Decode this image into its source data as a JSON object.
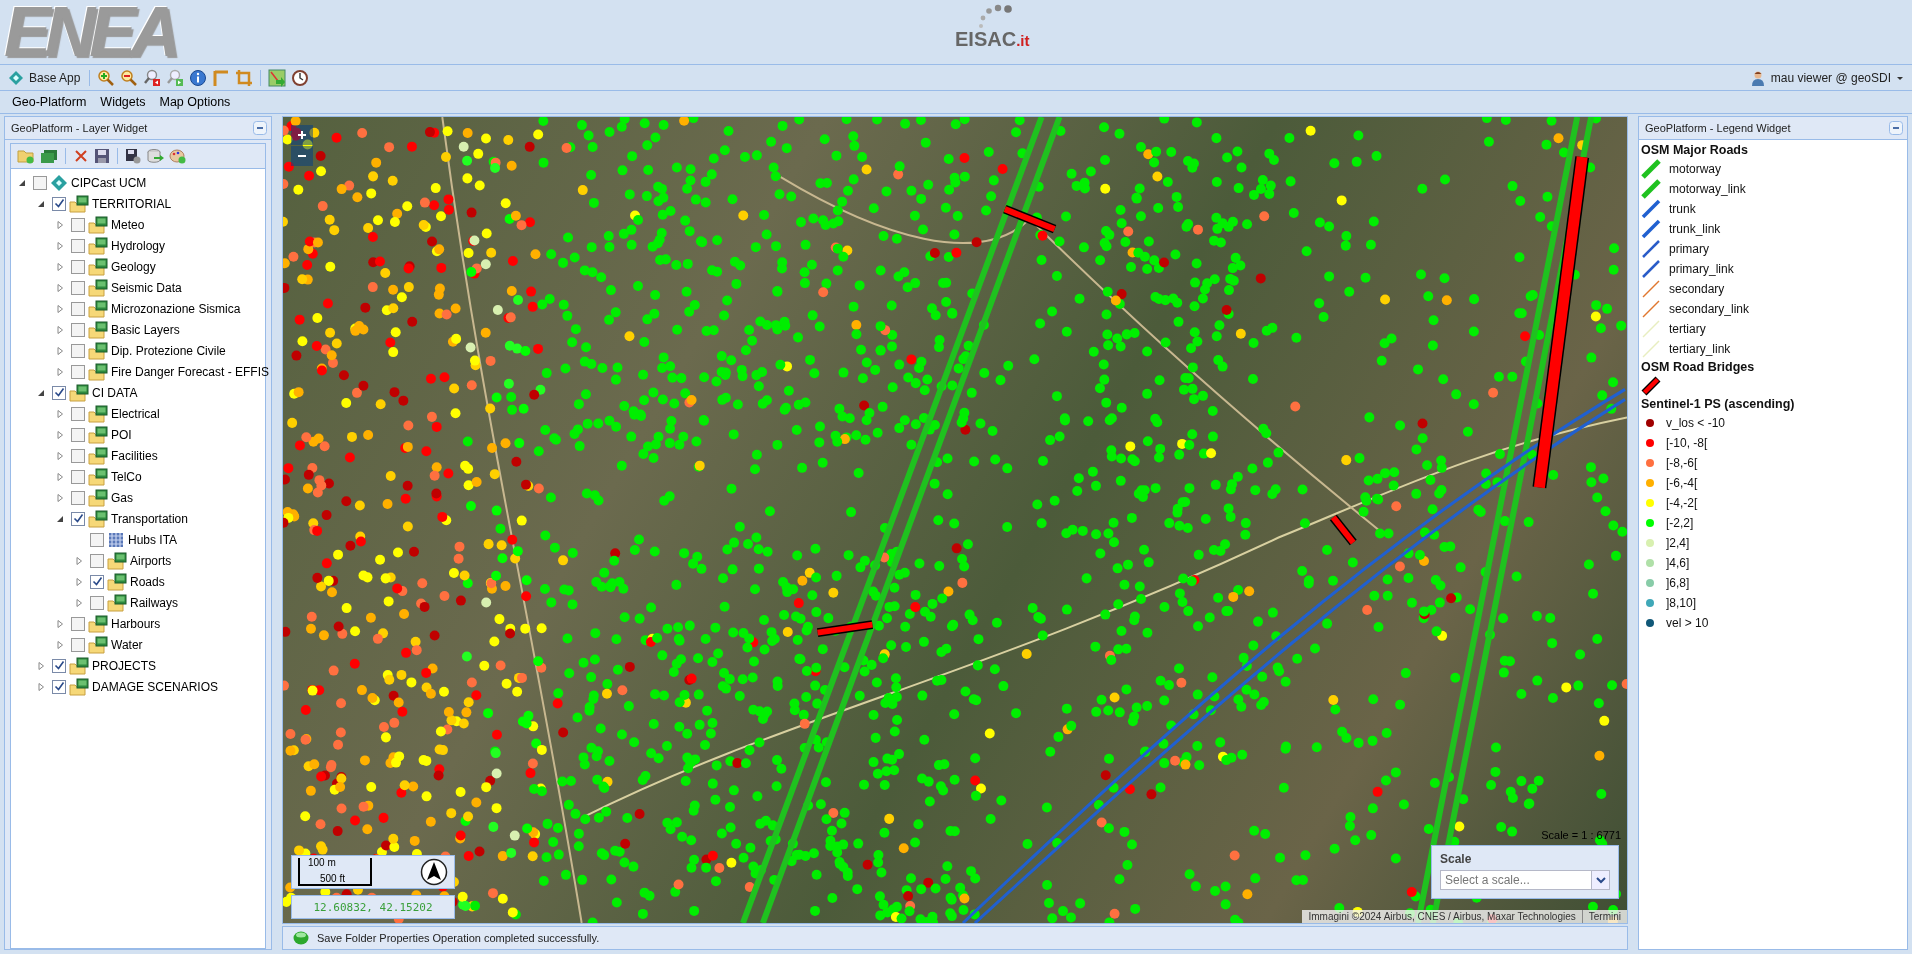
{
  "header": {
    "logo": "ENEA",
    "center_logo": {
      "name": "EISAC",
      "suffix": ".it"
    }
  },
  "toolbar": {
    "app_button": "Base App",
    "user": "mau viewer @ geoSDI"
  },
  "menu": [
    "Geo-Platform",
    "Widgets",
    "Map Options"
  ],
  "layer_widget": {
    "title": "GeoPlatform - Layer Widget",
    "tree": [
      {
        "label": "CIPCast UCM",
        "kind": "app",
        "checked": false,
        "expanded": true,
        "children": [
          {
            "label": "TERRITORIAL",
            "kind": "folder",
            "checked": true,
            "expanded": true,
            "children": [
              {
                "label": "Meteo",
                "kind": "folder",
                "checked": false,
                "expanded": false
              },
              {
                "label": "Hydrology",
                "kind": "folder",
                "checked": false,
                "expanded": false
              },
              {
                "label": "Geology",
                "kind": "folder",
                "checked": false,
                "expanded": false
              },
              {
                "label": "Seismic Data",
                "kind": "folder",
                "checked": false,
                "expanded": false
              },
              {
                "label": "Microzonazione Sismica",
                "kind": "folder",
                "checked": false,
                "expanded": false
              },
              {
                "label": "Basic Layers",
                "kind": "folder",
                "checked": false,
                "expanded": false
              },
              {
                "label": "Dip. Protezione Civile",
                "kind": "folder",
                "checked": false,
                "expanded": false
              },
              {
                "label": "Fire Danger Forecast - EFFIS",
                "kind": "folder",
                "checked": false,
                "expanded": false
              }
            ]
          },
          {
            "label": "CI DATA",
            "kind": "folder",
            "checked": true,
            "expanded": true,
            "children": [
              {
                "label": "Electrical",
                "kind": "folder",
                "checked": false,
                "expanded": false
              },
              {
                "label": "POI",
                "kind": "folder",
                "checked": false,
                "expanded": false
              },
              {
                "label": "Facilities",
                "kind": "folder",
                "checked": false,
                "expanded": false
              },
              {
                "label": "TelCo",
                "kind": "folder",
                "checked": false,
                "expanded": false
              },
              {
                "label": "Gas",
                "kind": "folder",
                "checked": false,
                "expanded": false
              },
              {
                "label": "Transportation",
                "kind": "folder",
                "checked": true,
                "expanded": true,
                "children": [
                  {
                    "label": "Hubs ITA",
                    "kind": "raster",
                    "checked": false
                  },
                  {
                    "label": "Airports",
                    "kind": "folder",
                    "checked": false,
                    "expanded": false
                  },
                  {
                    "label": "Roads",
                    "kind": "folder",
                    "checked": true,
                    "expanded": false
                  },
                  {
                    "label": "Railways",
                    "kind": "folder",
                    "checked": false,
                    "expanded": false
                  }
                ]
              },
              {
                "label": "Harbours",
                "kind": "folder",
                "checked": false,
                "expanded": false
              },
              {
                "label": "Water",
                "kind": "folder",
                "checked": false,
                "expanded": false
              }
            ]
          },
          {
            "label": "PROJECTS",
            "kind": "folder",
            "checked": true,
            "expanded": false
          },
          {
            "label": "DAMAGE SCENARIOS",
            "kind": "folder",
            "checked": true,
            "expanded": false
          }
        ]
      }
    ]
  },
  "map": {
    "scale_line": {
      "metric": "100 m",
      "imperial": "500 ft"
    },
    "coordinates": "12.60832, 42.15202",
    "scale_readout": "Scale = 1 : 6771",
    "scale_box": {
      "title": "Scale",
      "placeholder": "Select a scale..."
    },
    "attribution": "Immagini ©2024 Airbus, CNES / Airbus, Maxar Technologies",
    "terms": "Termini"
  },
  "status": {
    "message": "Save Folder Properties Operation completed successfully."
  },
  "legend_widget": {
    "title": "GeoPlatform - Legend Widget",
    "sections": [
      {
        "title": "OSM Major Roads",
        "items": [
          {
            "label": "motorway",
            "kind": "line-thick",
            "color": "#1fc21f"
          },
          {
            "label": "motorway_link",
            "kind": "line-thick",
            "color": "#1fc21f"
          },
          {
            "label": "trunk",
            "kind": "line-medium",
            "color": "#2060d0"
          },
          {
            "label": "trunk_link",
            "kind": "line-medium",
            "color": "#2060d0"
          },
          {
            "label": "primary",
            "kind": "line-thin",
            "color": "#2a5cc8"
          },
          {
            "label": "primary_link",
            "kind": "line-thin",
            "color": "#2a5cc8"
          },
          {
            "label": "secondary",
            "kind": "line-hair",
            "color": "#e07830"
          },
          {
            "label": "secondary_link",
            "kind": "line-hair",
            "color": "#e07830"
          },
          {
            "label": "tertiary",
            "kind": "line-hair",
            "color": "#e8eec0"
          },
          {
            "label": "tertiary_link",
            "kind": "line-hair",
            "color": "#e8eec0"
          }
        ]
      },
      {
        "title": "OSM Road Bridges",
        "items": [
          {
            "kind": "bridge",
            "color": "#ff0000"
          }
        ]
      },
      {
        "title": "Sentinel-1 PS (ascending)",
        "items": [
          {
            "label": "v_los < -10",
            "kind": "dot",
            "color": "#a00000"
          },
          {
            "label": "[-10, -8[",
            "kind": "dot",
            "color": "#ff0000"
          },
          {
            "label": "[-8,-6[",
            "kind": "dot",
            "color": "#ff7040"
          },
          {
            "label": "[-6,-4[",
            "kind": "dot",
            "color": "#ffb000"
          },
          {
            "label": "[-4,-2[",
            "kind": "dot",
            "color": "#ffff00"
          },
          {
            "label": "[-2,2]",
            "kind": "dot",
            "color": "#00ff00"
          },
          {
            "label": "]2,4]",
            "kind": "dot",
            "color": "#d8f0b0"
          },
          {
            "label": "]4,6]",
            "kind": "dot",
            "color": "#b0e0a8"
          },
          {
            "label": "]6,8]",
            "kind": "dot",
            "color": "#88cca8"
          },
          {
            "label": "]8,10]",
            "kind": "dot",
            "color": "#40a8b8"
          },
          {
            "label": "vel > 10",
            "kind": "dot",
            "color": "#105878"
          }
        ]
      }
    ]
  }
}
